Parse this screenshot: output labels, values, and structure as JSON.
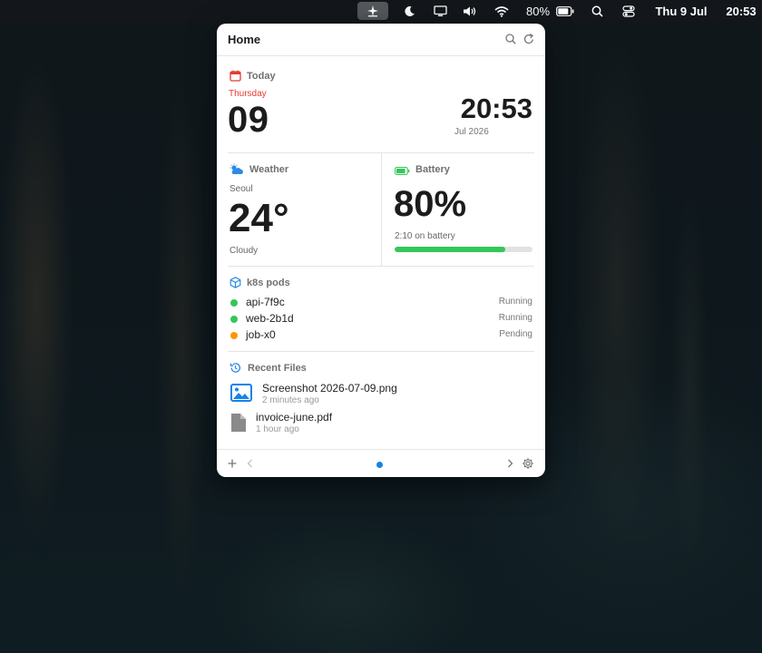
{
  "menubar": {
    "battery_pct": "80%",
    "date": "Thu 9 Jul",
    "time": "20:53",
    "icons": [
      "sparkle-icon",
      "moon-icon",
      "display-icon",
      "volume-icon",
      "wifi-icon",
      "battery-icon",
      "search-icon",
      "control-center-icon"
    ]
  },
  "panel": {
    "title": "Home",
    "today": {
      "label": "Today",
      "weekday": "Thursday",
      "day": "09",
      "time": "20:53",
      "month_year": "Jul 2026"
    },
    "weather": {
      "label": "Weather",
      "city": "Seoul",
      "temperature": "24°",
      "condition": "Cloudy"
    },
    "battery": {
      "label": "Battery",
      "percent": "80%",
      "remaining": "2:10 on battery",
      "level": 0.8
    },
    "pods": {
      "label": "k8s pods",
      "items": [
        {
          "name": "api-7f9c",
          "status": "Running",
          "color": "#34c759"
        },
        {
          "name": "web-2b1d",
          "status": "Running",
          "color": "#34c759"
        },
        {
          "name": "job-x0",
          "status": "Pending",
          "color": "#ff9500"
        }
      ]
    },
    "recent_files": {
      "label": "Recent Files",
      "items": [
        {
          "name": "Screenshot 2026-07-09.png",
          "time": "2 minutes ago",
          "icon": "image-file-icon"
        },
        {
          "name": "invoice-june.pdf",
          "time": "1 hour ago",
          "icon": "document-file-icon"
        }
      ]
    }
  },
  "colors": {
    "accent": "#1683e8",
    "today_red": "#e33b2e",
    "battery_green": "#34c759",
    "pending_orange": "#ff9500"
  }
}
